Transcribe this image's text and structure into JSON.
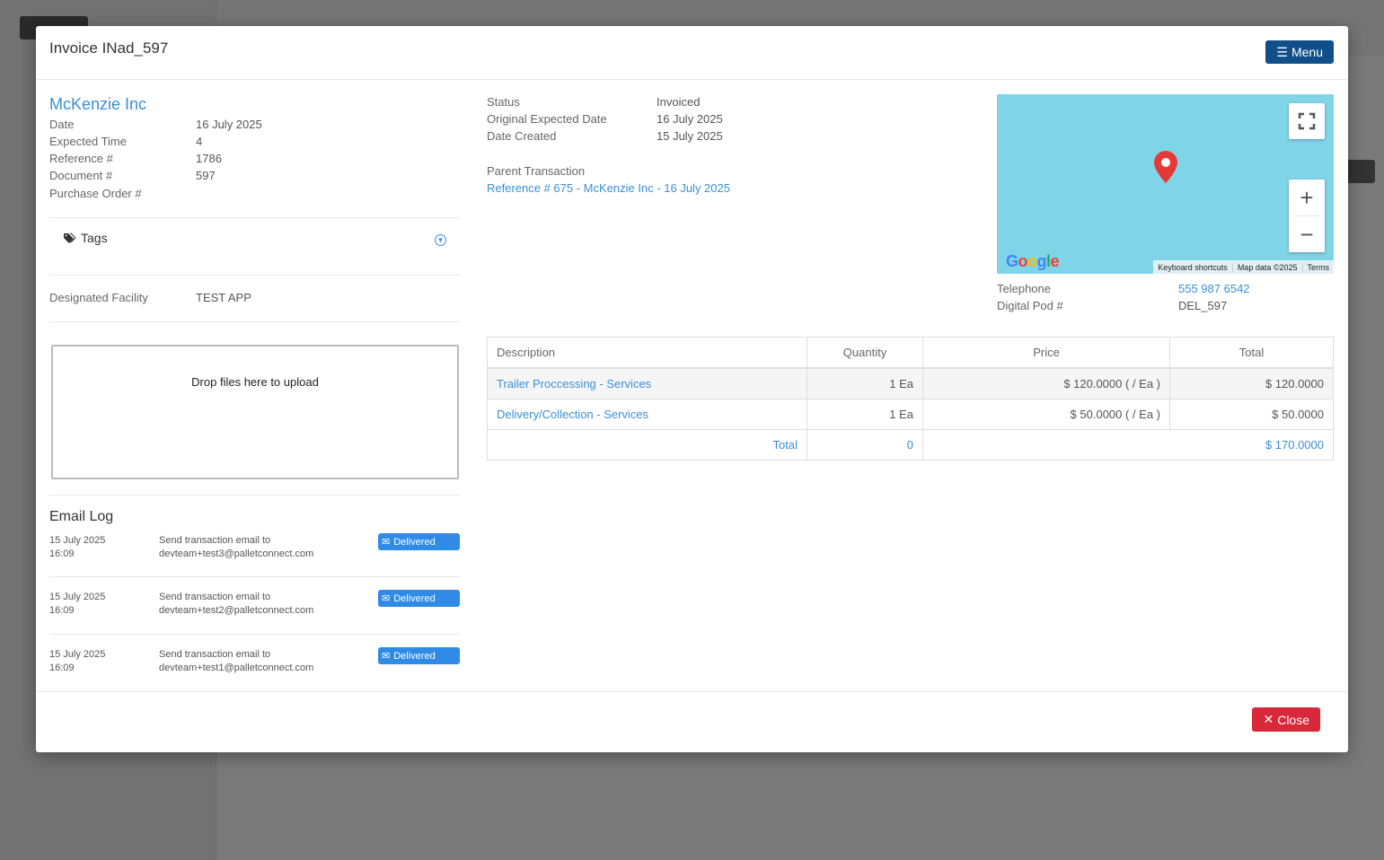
{
  "header": {
    "title": "Invoice INad_597",
    "menu_label": "Menu"
  },
  "details": {
    "company": "McKenzie Inc",
    "fields": [
      {
        "label": "Date",
        "value": "16 July 2025"
      },
      {
        "label": "Expected Time",
        "value": "4"
      },
      {
        "label": "Reference #",
        "value": "1786"
      },
      {
        "label": "Document #",
        "value": "597"
      },
      {
        "label": "Purchase Order #",
        "value": ""
      }
    ],
    "tags_label": "Tags",
    "facility_label": "Designated Facility",
    "facility_value": "TEST APP",
    "dropzone_text": "Drop files here to upload"
  },
  "status": {
    "fields": [
      {
        "label": "Status",
        "value": "Invoiced"
      },
      {
        "label": "Original Expected Date",
        "value": "16 July 2025"
      },
      {
        "label": "Date Created",
        "value": "15 July 2025"
      }
    ],
    "parent_label": "Parent Transaction",
    "parent_link": "Reference # 675 - McKenzie Inc - 16 July 2025"
  },
  "map": {
    "attribution_shortcuts": "Keyboard shortcuts",
    "attribution_data": "Map data ©2025",
    "attribution_terms": "Terms",
    "logo_text": "Google"
  },
  "contact": {
    "telephone_label": "Telephone",
    "telephone_value": "555 987 6542",
    "pod_label": "Digital Pod #",
    "pod_value": "DEL_597"
  },
  "items": {
    "headers": [
      "Description",
      "Quantity",
      "Price",
      "Total"
    ],
    "rows": [
      {
        "description": "Trailer Proccessing - Services",
        "quantity": "1 Ea",
        "price": "$ 120.0000 ( / Ea )",
        "total": "$ 120.0000"
      },
      {
        "description": "Delivery/Collection - Services",
        "quantity": "1 Ea",
        "price": "$ 50.0000 ( / Ea )",
        "total": "$ 50.0000"
      }
    ],
    "total_label": "Total",
    "total_quantity": "0",
    "total_value": "$ 170.0000"
  },
  "email_log": {
    "title": "Email Log",
    "entries": [
      {
        "date": "15 July 2025",
        "time": "16:09",
        "line1": "Send transaction email to",
        "line2": "devteam+test3@palletconnect.com",
        "status": "Delivered"
      },
      {
        "date": "15 July 2025",
        "time": "16:09",
        "line1": "Send transaction email to",
        "line2": "devteam+test2@palletconnect.com",
        "status": "Delivered"
      },
      {
        "date": "15 July 2025",
        "time": "16:09",
        "line1": "Send transaction email to",
        "line2": "devteam+test1@palletconnect.com",
        "status": "Delivered"
      }
    ]
  },
  "footer": {
    "close_label": "Close"
  },
  "colors": {
    "link": "#3a8fd9",
    "menu_button": "#114f8a",
    "close_button": "#d9283a",
    "badge": "#2f8be6",
    "map_water": "#80d4e8",
    "pin": "#e53935"
  }
}
